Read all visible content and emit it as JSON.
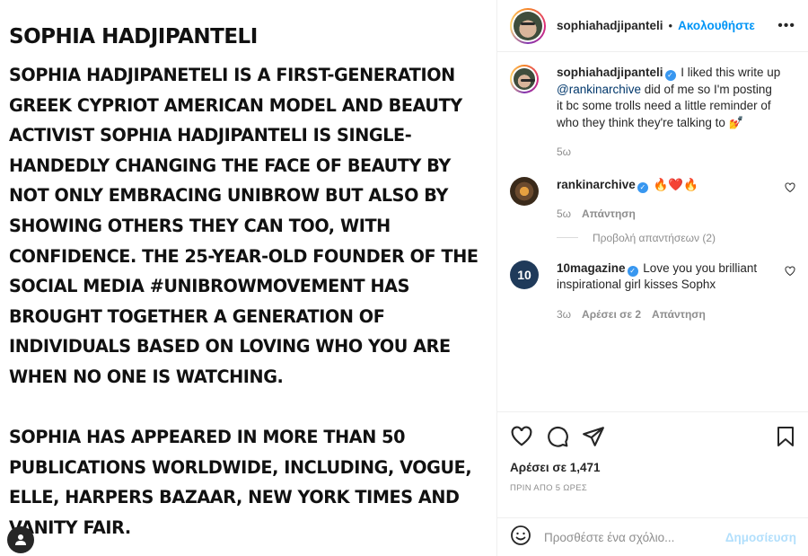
{
  "image": {
    "headline": "SOPHIA HADJIPANTELI",
    "body": "SOPHIA HADJIPANETELI IS A FIRST-GENERATION\nGREEK CYPRIOT AMERICAN MODEL AND BEAUTY\nACTIVIST SOPHIA HADJIPANTELI IS SINGLE-\nHANDEDLY CHANGING THE FACE OF BEAUTY BY\nNOT ONLY EMBRACING UNIBROW BUT ALSO BY\nSHOWING OTHERS THEY CAN TOO, WITH\nCONFIDENCE. THE 25-YEAR-OLD FOUNDER OF THE\nSOCIAL MEDIA #UNIBROWMOVEMENT HAS\nBROUGHT TOGETHER A GENERATION OF\nINDIVIDUALS BASED ON LOVING WHO YOU ARE\nWHEN NO ONE IS WATCHING.\n\nSOPHIA HAS APPEARED IN MORE THAN 50\nPUBLICATIONS WORLDWIDE, INCLUDING, VOGUE,\nELLE, HARPERS BAZAAR, NEW YORK TIMES AND\nVANITY FAIR."
  },
  "header": {
    "username": "sophiahadjipanteli",
    "separator": "•",
    "follow_label": "Ακολουθήστε",
    "more_label": "•••"
  },
  "caption": {
    "username": "sophiahadjipanteli",
    "verified_mark": "✓",
    "text_before": " I liked this write up ",
    "mention": "@rankinarchive",
    "text_after": " did of me so I'm posting it bc some trolls need a little reminder of who they think they're talking to 💅",
    "time": "5ω"
  },
  "comments": [
    {
      "username": "rankinarchive",
      "verified_mark": "✓",
      "text": " 🔥❤️🔥",
      "time": "5ω",
      "likes": "",
      "reply_label": "Απάντηση"
    },
    {
      "username": "10magazine",
      "avatar_text": "10",
      "verified_mark": "✓",
      "text": " Love you you brilliant inspirational girl kisses Sophx",
      "time": "3ω",
      "likes": "Αρέσει σε 2",
      "reply_label": "Απάντηση"
    }
  ],
  "view_replies_label": "Προβολή απαντήσεων (2)",
  "likes_label": "Αρέσει σε 1,471",
  "time_ago": "ΠΡΙΝ ΑΠΟ 5 ΩΡΕΣ",
  "add_comment": {
    "placeholder": "Προσθέστε ένα σχόλιο...",
    "post_label": "Δημοσίευση"
  },
  "icons": [
    "user-tag-icon",
    "heart-icon",
    "comment-icon",
    "share-icon",
    "bookmark-icon",
    "emoji-icon"
  ],
  "colors": {
    "link_blue": "#0095f6",
    "post_disabled": "#b2dffc",
    "muted": "#8e8e8e"
  }
}
